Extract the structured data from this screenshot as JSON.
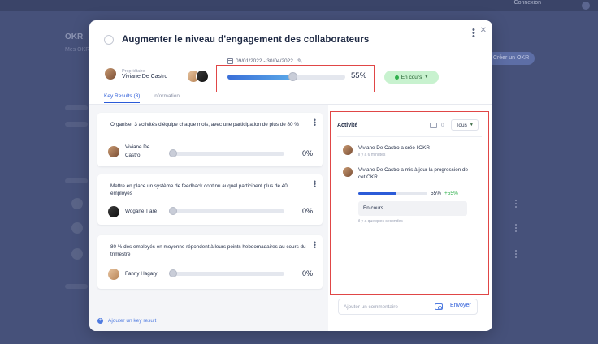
{
  "background": {
    "topbar_text": "Connexion",
    "title": "OKR",
    "subtitle": "Mes OKR",
    "button_label": "Créer un OKR"
  },
  "modal": {
    "title": "Augmenter le niveau d'engagement des collaborateurs",
    "owner_label": "Propriétaire",
    "owner_name": "Viviane De Castro",
    "dates": "09/01/2022 - 30/04/2022",
    "progress_pct_text": "55%",
    "progress_value": 0.55,
    "status": "En cours",
    "tabs": [
      "Key Results (3)",
      "Information"
    ],
    "key_results": [
      {
        "title": "Organiser 3 activités d'équipe chaque mois, avec une participation de plus de 80 %",
        "owner": "Viviane De Castro",
        "pct": "0%",
        "value": 0
      },
      {
        "title": "Mettre en place un système de feedback continu auquel participent plus de 40 employés",
        "owner": "Wogane Tiaré",
        "pct": "0%",
        "value": 0
      },
      {
        "title": "80 % des employés en moyenne répondent à leurs points hebdomadaires au cours du trimestre",
        "owner": "Fanny Hagary",
        "pct": "0%",
        "value": 0
      }
    ],
    "add_kr_label": "Ajouter un key result"
  },
  "activity": {
    "title": "Activité",
    "count": "0",
    "filter": "Tous",
    "events": [
      {
        "text": "Viviane De Castro a créé l'OKR",
        "time": "il y a 6 minutes"
      },
      {
        "text": "Viviane De Castro a mis à jour la progression de cet OKR",
        "time": "il y a quelques secondes"
      }
    ],
    "update_pct": "55%",
    "update_delta": "+55%",
    "update_value": 0.55,
    "update_status": "En cours...",
    "comment_placeholder": "Ajouter un commentaire",
    "send_label": "Envoyer"
  },
  "colors": {
    "accent": "#2b5bd8",
    "status_green": "#c8f2cf",
    "highlight": "#e04646"
  }
}
